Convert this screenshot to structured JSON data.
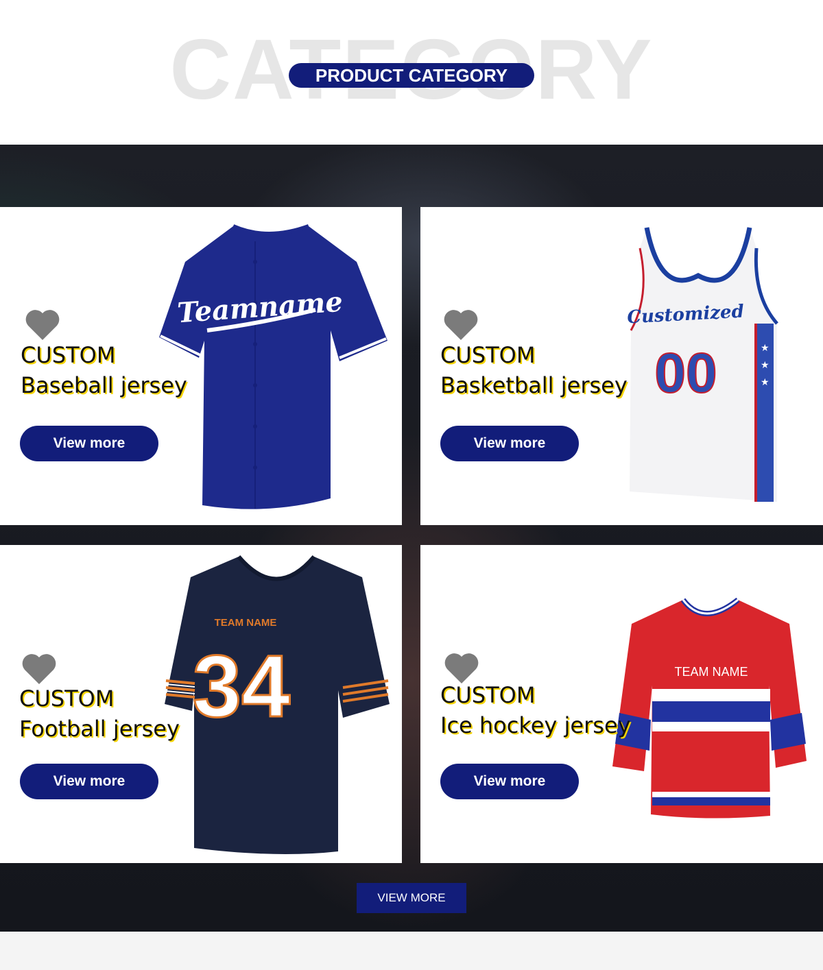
{
  "header": {
    "background_word": "CATEGORY",
    "title": "PRODUCT CATEGORY"
  },
  "colors": {
    "accent": "#121d7a",
    "highlight": "#f5d400",
    "heart": "#7b7b7b"
  },
  "cards": [
    {
      "custom": "CUSTOM",
      "name": "Baseball jersey",
      "button": "View more",
      "jersey_text": "Teamname"
    },
    {
      "custom": "CUSTOM",
      "name": "Basketball jersey",
      "button": "View more",
      "jersey_text": "Customized",
      "jersey_number": "00"
    },
    {
      "custom": "CUSTOM",
      "name": "Football jersey",
      "button": "View more",
      "jersey_text": "TEAM NAME",
      "jersey_number": "34"
    },
    {
      "custom": "CUSTOM",
      "name": "Ice hockey jersey",
      "button": "View more",
      "jersey_text": "TEAM NAME"
    }
  ],
  "main_button": "VIEW MORE"
}
